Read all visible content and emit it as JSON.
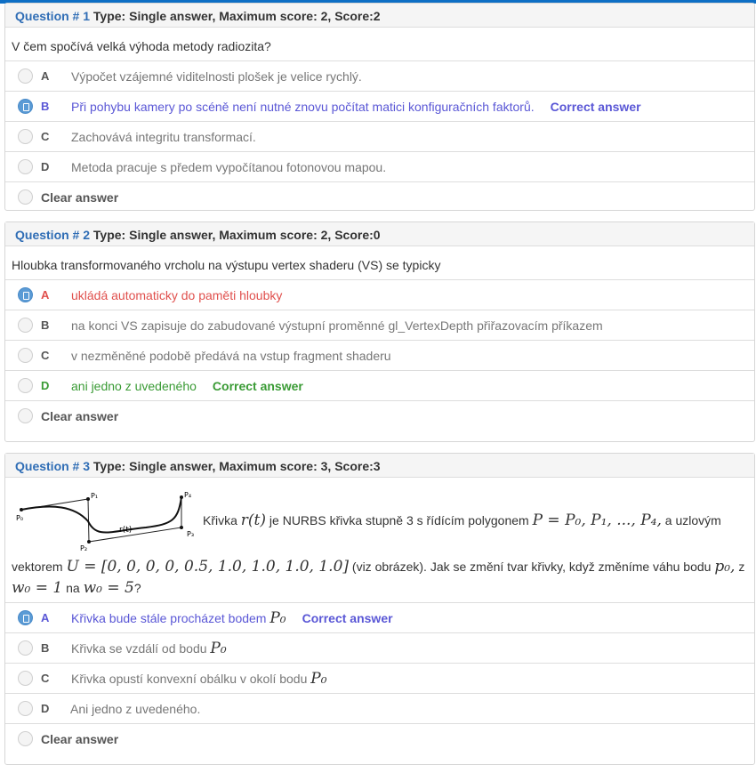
{
  "questions": [
    {
      "label": "Question # 1",
      "meta": "Type: Single answer, Maximum score: 2, Score:2",
      "text": "V čem spočívá velká výhoda metody radiozita?",
      "options": [
        {
          "letter": "A",
          "text": "Výpočet vzájemné viditelnosti plošek je velice rychlý."
        },
        {
          "letter": "B",
          "text": "Při pohybu kamery po scéně není nutné znovu počítat matici konfiguračních faktorů.",
          "badge": "Correct answer"
        },
        {
          "letter": "C",
          "text": "Zachovává integritu transformací."
        },
        {
          "letter": "D",
          "text": "Metoda pracuje s předem vypočítanou fotonovou mapou."
        }
      ],
      "clear_label": "Clear answer"
    },
    {
      "label": "Question # 2",
      "meta": "Type: Single answer, Maximum score: 2, Score:0",
      "text": "Hloubka transformovaného vrcholu na výstupu vertex shaderu (VS) se typicky",
      "options": [
        {
          "letter": "A",
          "text": "ukládá automaticky do paměti hloubky"
        },
        {
          "letter": "B",
          "text": "na konci VS zapisuje do zabudované výstupní proměnné gl_VertexDepth přiřazovacím příkazem"
        },
        {
          "letter": "C",
          "text": "v nezměněné podobě předává na vstup fragment shaderu"
        },
        {
          "letter": "D",
          "text": "ani jedno z uvedeného",
          "badge": "Correct answer"
        }
      ],
      "clear_label": "Clear answer"
    },
    {
      "label": "Question # 3",
      "meta": "Type: Single answer, Maximum score: 3, Score:3",
      "text_parts": {
        "p1": "Křivka",
        "m_r": "r(t)",
        "p2": "je NURBS křivka stupně 3 s řídícím polygonem",
        "m_P": "P = P₀, P₁, ..., P₄,",
        "p3": "a uzlovým",
        "p4": "vektorem",
        "m_U": "U = [0, 0, 0, 0, 0.5, 1.0, 1.0, 1.0, 1.0]",
        "p5": "(viz obrázek). Jak se změní tvar křivky, když změníme váhu bodu",
        "m_p0": "p₀,",
        "p6": "z",
        "m_w0a": "w₀ = 1",
        "p7": "na",
        "m_w0b": "w₀ = 5",
        "p8": "?"
      },
      "figure_labels": {
        "p0": "P₀",
        "p1": "P₁",
        "p2": "P₂",
        "p3": "P₃",
        "p4": "P₄",
        "rt": "r(t)"
      },
      "options": [
        {
          "letter": "A",
          "text": "Křivka bude stále procházet bodem",
          "math": "P₀",
          "badge": "Correct answer"
        },
        {
          "letter": "B",
          "text": "Křivka se vzdálí od bodu",
          "math": "P₀"
        },
        {
          "letter": "C",
          "text": "Křivka opustí konvexní obálku v okolí bodu",
          "math": "P₀"
        },
        {
          "letter": "D",
          "text": "Ani jedno z uvedeného."
        }
      ],
      "clear_label": "Clear answer"
    }
  ],
  "colors": {
    "accent": "#0e6fc5",
    "selected_correct": "#5a57d6",
    "wrong": "#e0504d",
    "correct": "#3a9b35"
  }
}
